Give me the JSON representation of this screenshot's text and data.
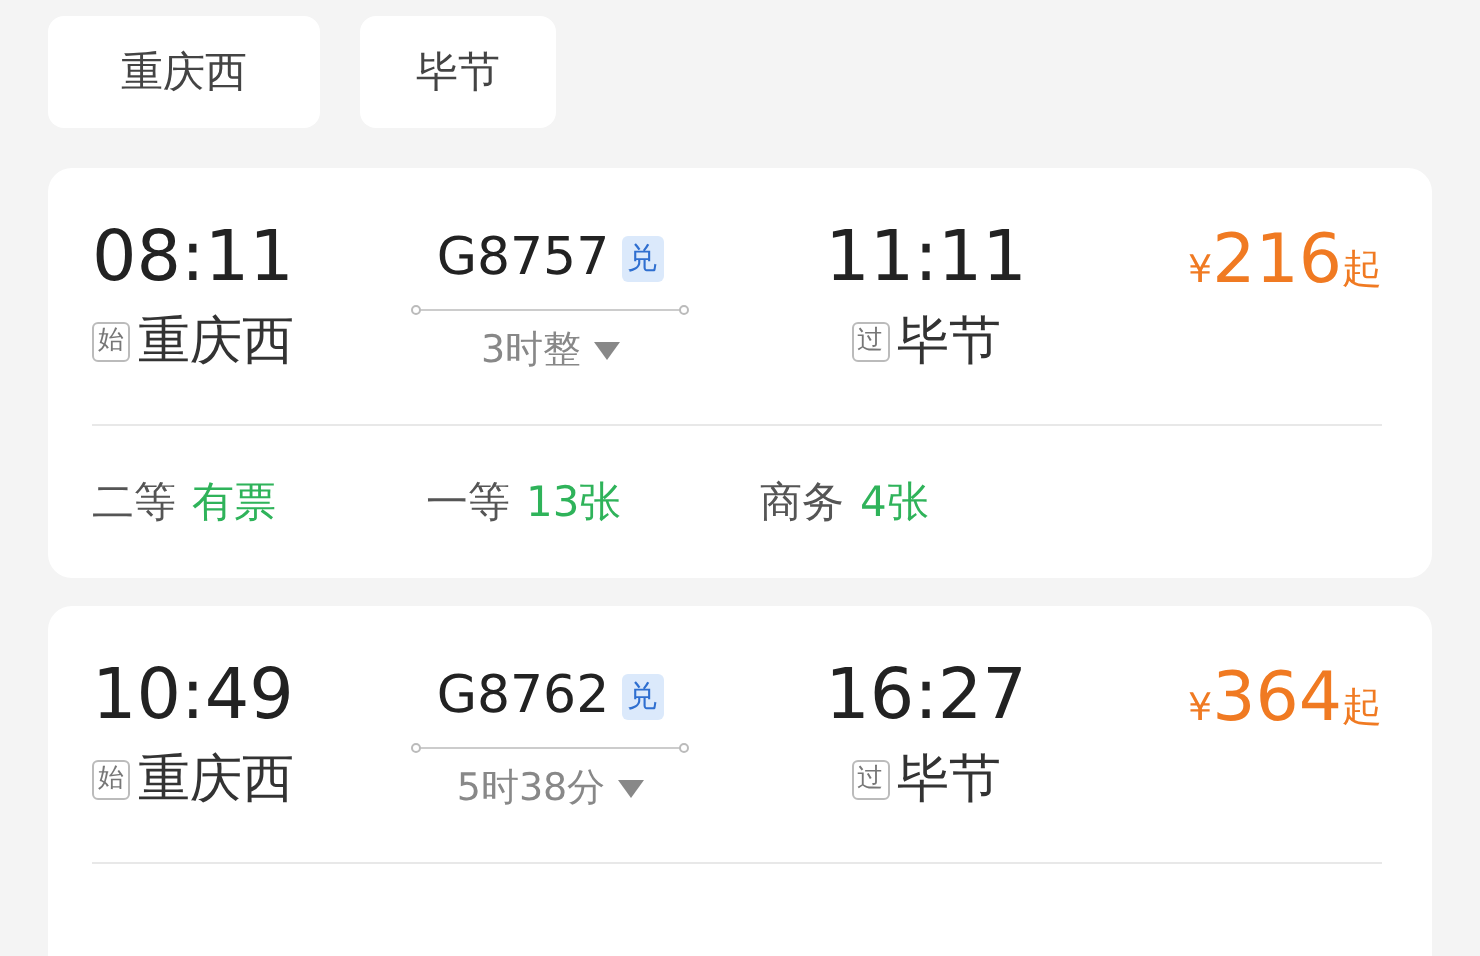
{
  "stations": [
    "重庆西",
    "毕节"
  ],
  "trains": [
    {
      "dep_time": "08:11",
      "dep_tag": "始",
      "dep_station": "重庆西",
      "train_no": "G8757",
      "badge": "兑",
      "duration": "3时整",
      "arr_time": "11:11",
      "arr_tag": "过",
      "arr_station": "毕节",
      "currency": "¥",
      "price": "216",
      "price_suffix": "起",
      "seats": [
        {
          "class": "二等",
          "status": "有票",
          "kind": "available"
        },
        {
          "class": "一等",
          "status": "13张",
          "kind": "available"
        },
        {
          "class": "商务",
          "status": "4张",
          "kind": "available"
        }
      ]
    },
    {
      "dep_time": "10:49",
      "dep_tag": "始",
      "dep_station": "重庆西",
      "train_no": "G8762",
      "badge": "兑",
      "duration": "5时38分",
      "arr_time": "16:27",
      "arr_tag": "过",
      "arr_station": "毕节",
      "currency": "¥",
      "price": "364",
      "price_suffix": "起"
    }
  ]
}
